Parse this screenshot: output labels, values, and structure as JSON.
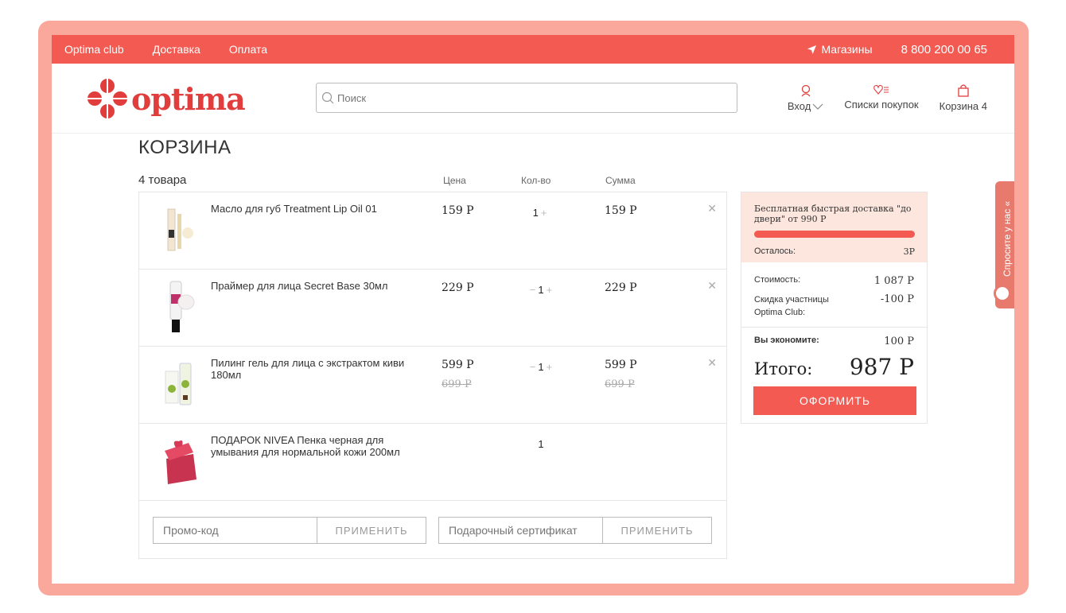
{
  "topbar": {
    "links": [
      "Optima club",
      "Доставка",
      "Оплата"
    ],
    "stores": "Магазины",
    "phone": "8 800 200 00 65"
  },
  "header": {
    "logo": "optima",
    "search_placeholder": "Поиск",
    "login": "Вход",
    "lists": "Списки покупок",
    "cart": "Корзина 4"
  },
  "page": {
    "title": "КОРЗИНА",
    "count": "4 товара",
    "col_price": "Цена",
    "col_qty": "Кол-во",
    "col_sum": "Сумма"
  },
  "items": [
    {
      "name": "Масло для губ Treatment Lip Oil 01",
      "price": "159 Р",
      "old_price": "",
      "qty": "1",
      "sum": "159 Р",
      "old_sum": ""
    },
    {
      "name": "Праймер для лица Secret Base 30мл",
      "price": "229 Р",
      "old_price": "",
      "qty": "1",
      "sum": "229 Р",
      "old_sum": ""
    },
    {
      "name": "Пилинг гель для лица с экстрактом киви 180мл",
      "price": "599 Р",
      "old_price": "699 Р",
      "qty": "1",
      "sum": "599 Р",
      "old_sum": "699 Р"
    },
    {
      "name": "ПОДАРОК NIVEA Пенка черная для умывания для нормальной кожи 200мл",
      "qty": "1"
    }
  ],
  "promo": {
    "code_placeholder": "Промо-код",
    "cert_placeholder": "Подарочный сертификат",
    "apply": "ПРИМЕНИТЬ"
  },
  "summary": {
    "shipping_text": "Бесплатная быстрая доставка \"до двери\" от 990 Р",
    "remaining_label": "Осталось:",
    "remaining_value": "3Р",
    "cost_label": "Стоимость:",
    "cost_value": "1 087 Р",
    "discount_label": "Скидка участницы Optima Club:",
    "discount_value": "-100 Р",
    "save_label": "Вы экономите:",
    "save_value": "100 Р",
    "total_label": "Итого:",
    "total_value": "987 Р",
    "checkout": "ОФОРМИТЬ"
  },
  "ask_tab": "Спросите у нас «",
  "colors": {
    "accent": "#f25a52",
    "frame": "#f9a89b",
    "ship_bg": "#fde6dd"
  }
}
